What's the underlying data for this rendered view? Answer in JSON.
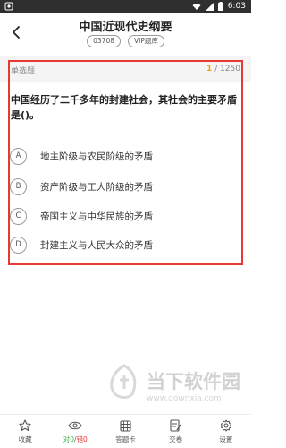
{
  "status_bar": {
    "time": "6:03"
  },
  "header": {
    "title": "中国近现代史纲要",
    "tags": [
      "03708",
      "VIP题库"
    ]
  },
  "question_meta": {
    "type": "单选题",
    "current": "1",
    "total": "/ 1250"
  },
  "question": {
    "text": "中国经历了二千多年的封建社会，其社会的主要矛盾是()。",
    "options": [
      {
        "letter": "A",
        "text": "地主阶级与农民阶级的矛盾"
      },
      {
        "letter": "B",
        "text": "资产阶级与工人阶级的矛盾"
      },
      {
        "letter": "C",
        "text": "帝国主义与中华民族的矛盾"
      },
      {
        "letter": "D",
        "text": "封建主义与人民大众的矛盾"
      }
    ]
  },
  "watermark": {
    "brand": "当下软件园",
    "url": "www.downxia.com"
  },
  "toolbar": {
    "collect": "收藏",
    "right_label": "对0",
    "sep": "/",
    "wrong_label": "错0",
    "answer_card": "答题卡",
    "submit": "交卷",
    "settings": "设置"
  },
  "colors": {
    "highlight": "#e53935",
    "progress_current": "#e9a41a",
    "correct": "#43b048",
    "wrong": "#e53935"
  }
}
